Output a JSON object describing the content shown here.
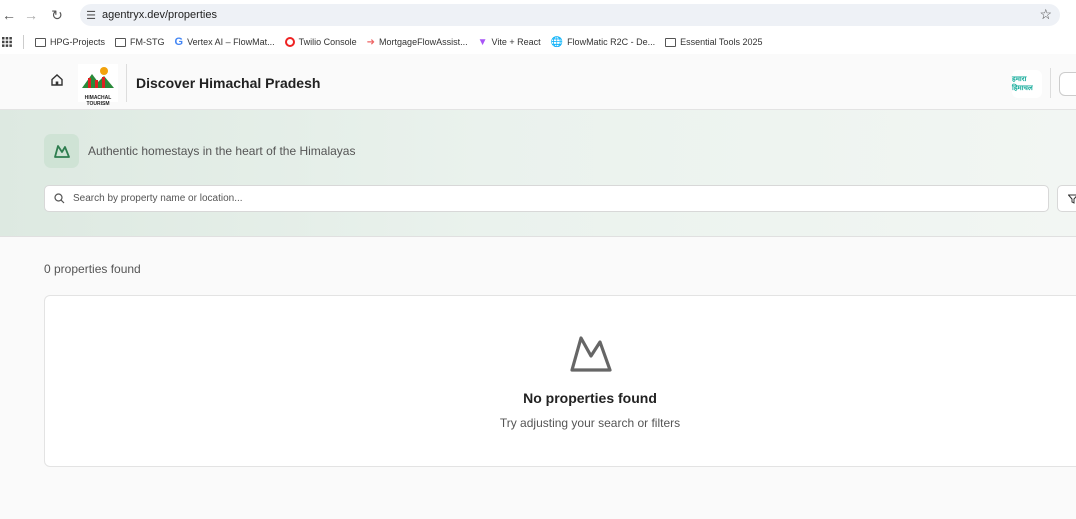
{
  "browser": {
    "url": "agentryx.dev/properties",
    "bookmarks": [
      {
        "label": "HPG-Projects",
        "icon": "folder-icon"
      },
      {
        "label": "FM-STG",
        "icon": "folder-icon"
      },
      {
        "label": "Vertex AI – FlowMat...",
        "icon": "google-icon"
      },
      {
        "label": "Twilio Console",
        "icon": "twilio-icon"
      },
      {
        "label": "MortgageFlowAssist...",
        "icon": "flow-icon"
      },
      {
        "label": "Vite + React",
        "icon": "vite-icon"
      },
      {
        "label": "FlowMatic R2C - De...",
        "icon": "globe-icon"
      },
      {
        "label": "Essential Tools 2025",
        "icon": "folder-icon"
      }
    ]
  },
  "header": {
    "title": "Discover Himachal Pradesh",
    "logo_text": "HIMACHAL TOURISM",
    "badge_text": "हमारा हिमाचल"
  },
  "hero": {
    "tagline": "Authentic homestays in the heart of the Himalayas",
    "search_placeholder": "Search by property name or location..."
  },
  "results": {
    "count_text": "0 properties found",
    "empty_title": "No properties found",
    "empty_subtitle": "Try adjusting your search or filters"
  },
  "colors": {
    "accent": "#2e7d4f",
    "hero_bg": "#e4eee7"
  }
}
